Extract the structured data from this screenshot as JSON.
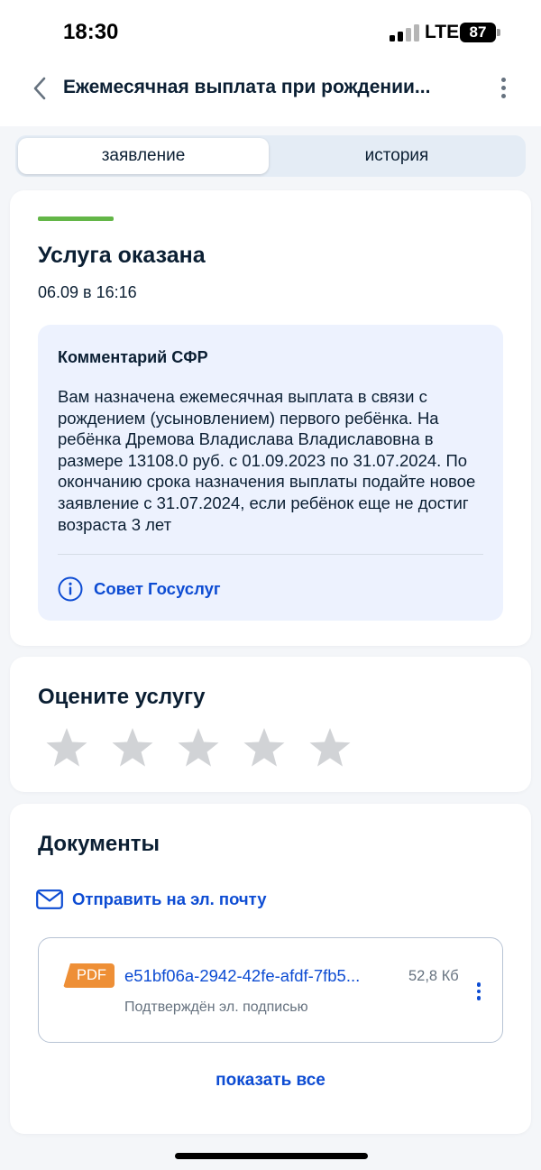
{
  "status_bar": {
    "time": "18:30",
    "network": "LTE",
    "battery": "87"
  },
  "header": {
    "title": "Ежемесячная выплата при рождении...",
    "back_icon": "chevron-left-icon",
    "more_icon": "more-vertical-icon"
  },
  "tabs": [
    {
      "label": "заявление",
      "active": true
    },
    {
      "label": "история",
      "active": false
    }
  ],
  "status_card": {
    "accent_color": "#63b647",
    "title": "Услуга оказана",
    "date": "06.09 в 16:16",
    "comment": {
      "title": "Комментарий СФР",
      "text": "Вам назначена ежемесячная выплата в связи с рождением (усыновлением) первого ребёнка. На ребёнка Дремова Владислава Владиславовна в размере 13108.0 руб. с 01.09.2023 по 31.07.2024. По окончанию срока назначения выплаты подайте новое заявление с 31.07.2024, если ребёнок еще не достиг возраста 3 лет",
      "tip_label": "Совет Госуслуг",
      "tip_icon": "info-icon"
    }
  },
  "rating_card": {
    "title": "Оцените услугу",
    "max_stars": 5,
    "rating": 0
  },
  "documents_card": {
    "title": "Документы",
    "email_label": "Отправить на эл. почту",
    "email_icon": "mail-icon",
    "file": {
      "type": "PDF",
      "name": "e51bf06a-2942-42fe-afdf-7fb5...",
      "size": "52,8 Кб",
      "status": "Подтверждён эл. подписью"
    },
    "show_all_label": "показать все"
  },
  "colors": {
    "link": "#0d4cd3",
    "success": "#63b647",
    "pdf_badge": "#ee8f36"
  }
}
